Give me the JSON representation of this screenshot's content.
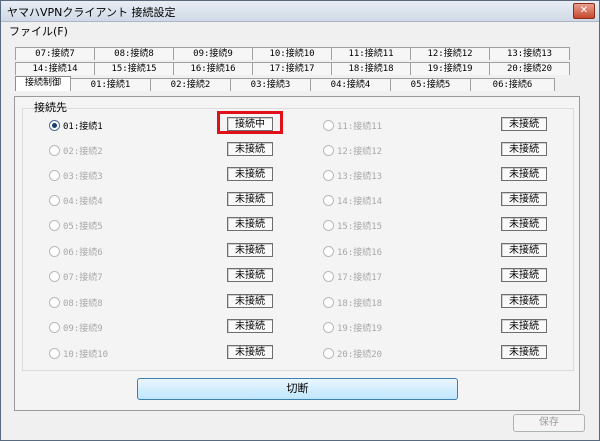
{
  "window": {
    "title": "ヤマハVPNクライアント 接続設定",
    "close_glyph": "✕"
  },
  "menu": {
    "file": "ファイル(F)"
  },
  "tabs": {
    "row1": [
      "07:接続7",
      "08:接続8",
      "09:接続9",
      "10:接続10",
      "11:接続11",
      "12:接続12",
      "13:接続13"
    ],
    "row2": [
      "14:接続14",
      "15:接続15",
      "16:接続16",
      "17:接続17",
      "18:接続18",
      "19:接続19",
      "20:接続20"
    ],
    "row3": [
      "接続制御",
      "01:接続1",
      "02:接続2",
      "03:接続3",
      "04:接続4",
      "05:接続5",
      "06:接続6"
    ]
  },
  "group": {
    "label": "接続先"
  },
  "connections": {
    "left": [
      {
        "label": "01:接続1",
        "status": "接続中",
        "checked": true
      },
      {
        "label": "02:接続2",
        "status": "未接続"
      },
      {
        "label": "03:接続3",
        "status": "未接続"
      },
      {
        "label": "04:接続4",
        "status": "未接続"
      },
      {
        "label": "05:接続5",
        "status": "未接続"
      },
      {
        "label": "06:接続6",
        "status": "未接続"
      },
      {
        "label": "07:接続7",
        "status": "未接続"
      },
      {
        "label": "08:接続8",
        "status": "未接続"
      },
      {
        "label": "09:接続9",
        "status": "未接続"
      },
      {
        "label": "10:接続10",
        "status": "未接続"
      }
    ],
    "right": [
      {
        "label": "11:接続11",
        "status": "未接続"
      },
      {
        "label": "12:接続12",
        "status": "未接続"
      },
      {
        "label": "13:接続13",
        "status": "未接続"
      },
      {
        "label": "14:接続14",
        "status": "未接続"
      },
      {
        "label": "15:接続15",
        "status": "未接続"
      },
      {
        "label": "16:接続16",
        "status": "未接続"
      },
      {
        "label": "17:接続17",
        "status": "未接続"
      },
      {
        "label": "18:接続18",
        "status": "未接続"
      },
      {
        "label": "19:接続19",
        "status": "未接続"
      },
      {
        "label": "20:接続20",
        "status": "未接続"
      }
    ]
  },
  "buttons": {
    "disconnect": "切断",
    "save": "保存"
  },
  "colors": {
    "highlight": "#e0101a",
    "accent": "#3c7fb1"
  }
}
